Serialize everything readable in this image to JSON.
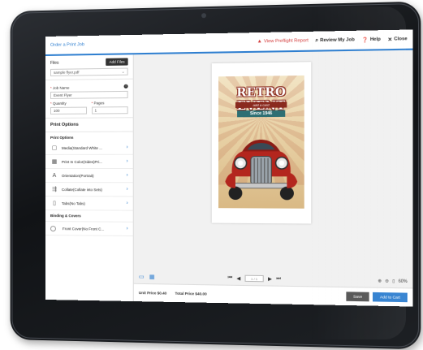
{
  "topbar": {
    "title": "Order a Print Job",
    "preflight": "View Preflight Report",
    "review": "Review My Job",
    "help": "Help",
    "close": "Close"
  },
  "left": {
    "files_label": "Files",
    "add_files": "Add Files",
    "file_selected": "sample flyer.pdf",
    "job_name_label": "Job Name",
    "job_name_value": "Event Flyer",
    "quantity_label": "Quantity",
    "quantity_value": "100",
    "pages_label": "Pages",
    "pages_value": "1",
    "print_options_header": "Print Options",
    "print_options_sub": "Print Options",
    "options": [
      {
        "label": "Media(Standard White ..."
      },
      {
        "label": "Print In Color(Sides)Pri..."
      },
      {
        "label": "Orientation(Portrait)"
      },
      {
        "label": "Collate(Collate into Sets)"
      },
      {
        "label": "Tabs(No Tabs)"
      }
    ],
    "binding_header": "Binding & Covers",
    "front_cover": "Front Cover(No Front C..."
  },
  "canvas": {
    "art_title": "RETRO EVENT",
    "art_sub": "add a card",
    "art_since": "Since 1946",
    "pager_value": "1 / 1",
    "zoom": "60%"
  },
  "bottombar": {
    "unit_price_label": "Unit Price",
    "unit_price": "$0.40",
    "total_price_label": "Total Price",
    "total_price": "$40.00",
    "save": "Save",
    "add_to_cart": "Add to Cart"
  },
  "colors": {
    "accent": "#2f7fd0",
    "alert": "#d33b3b",
    "car_red": "#b3261e"
  }
}
